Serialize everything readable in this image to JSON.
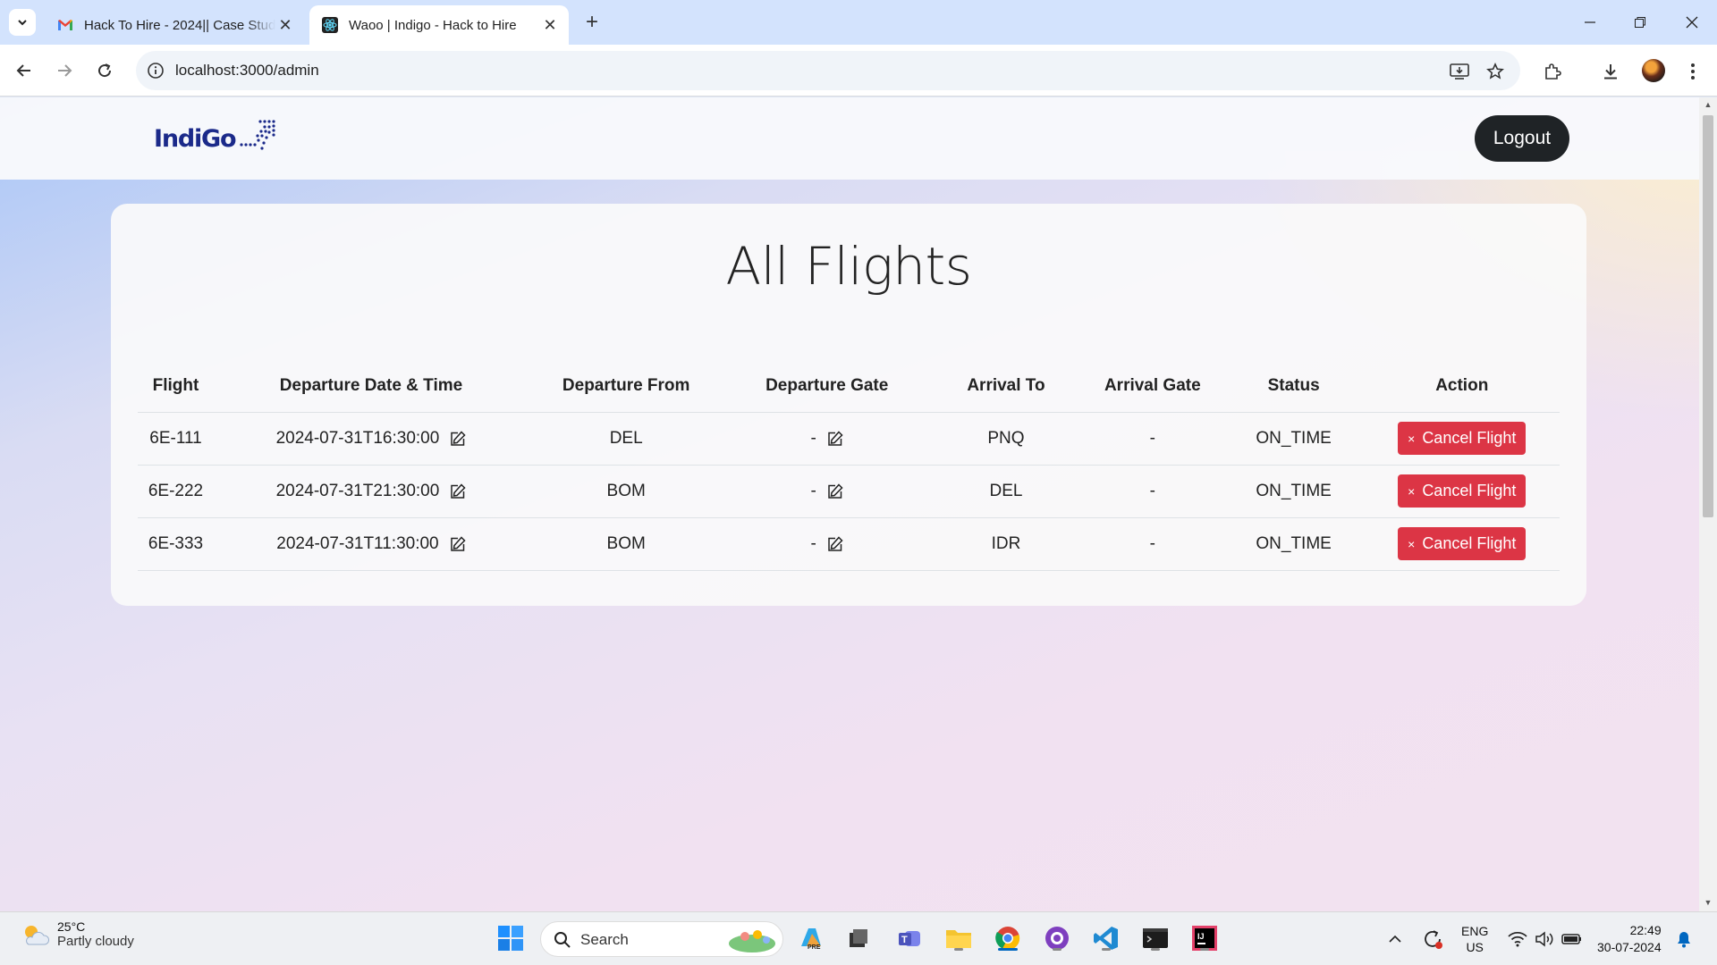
{
  "browser": {
    "tabs": [
      {
        "title": "Hack To Hire - 2024|| Case Study",
        "icon": "gmail-icon",
        "active": false
      },
      {
        "title": "Waoo | Indigo - Hack to Hire",
        "icon": "react-icon",
        "active": true
      }
    ],
    "url": "localhost:3000/admin"
  },
  "header": {
    "logo_text": "IndiGo",
    "logout_label": "Logout"
  },
  "main": {
    "title": "All Flights",
    "columns": [
      "Flight",
      "Departure Date & Time",
      "Departure From",
      "Departure Gate",
      "Arrival To",
      "Arrival Gate",
      "Status",
      "Action"
    ],
    "rows": [
      {
        "flight": "6E-111",
        "departure": "2024-07-31T16:30:00",
        "from": "DEL",
        "dep_gate": "-",
        "to": "PNQ",
        "arr_gate": "-",
        "status": "ON_TIME",
        "action": "Cancel Flight"
      },
      {
        "flight": "6E-222",
        "departure": "2024-07-31T21:30:00",
        "from": "BOM",
        "dep_gate": "-",
        "to": "DEL",
        "arr_gate": "-",
        "status": "ON_TIME",
        "action": "Cancel Flight"
      },
      {
        "flight": "6E-333",
        "departure": "2024-07-31T11:30:00",
        "from": "BOM",
        "dep_gate": "-",
        "to": "IDR",
        "arr_gate": "-",
        "status": "ON_TIME",
        "action": "Cancel Flight"
      }
    ],
    "cancel_glyph": "×"
  },
  "taskbar": {
    "weather_temp": "25°C",
    "weather_desc": "Partly cloudy",
    "search_label": "Search",
    "lang_top": "ENG",
    "lang_bottom": "US",
    "time": "22:49",
    "date": "30-07-2024"
  },
  "colors": {
    "danger": "#dc3545",
    "logout_bg": "#1f2326",
    "brand": "#1b2a8a"
  }
}
